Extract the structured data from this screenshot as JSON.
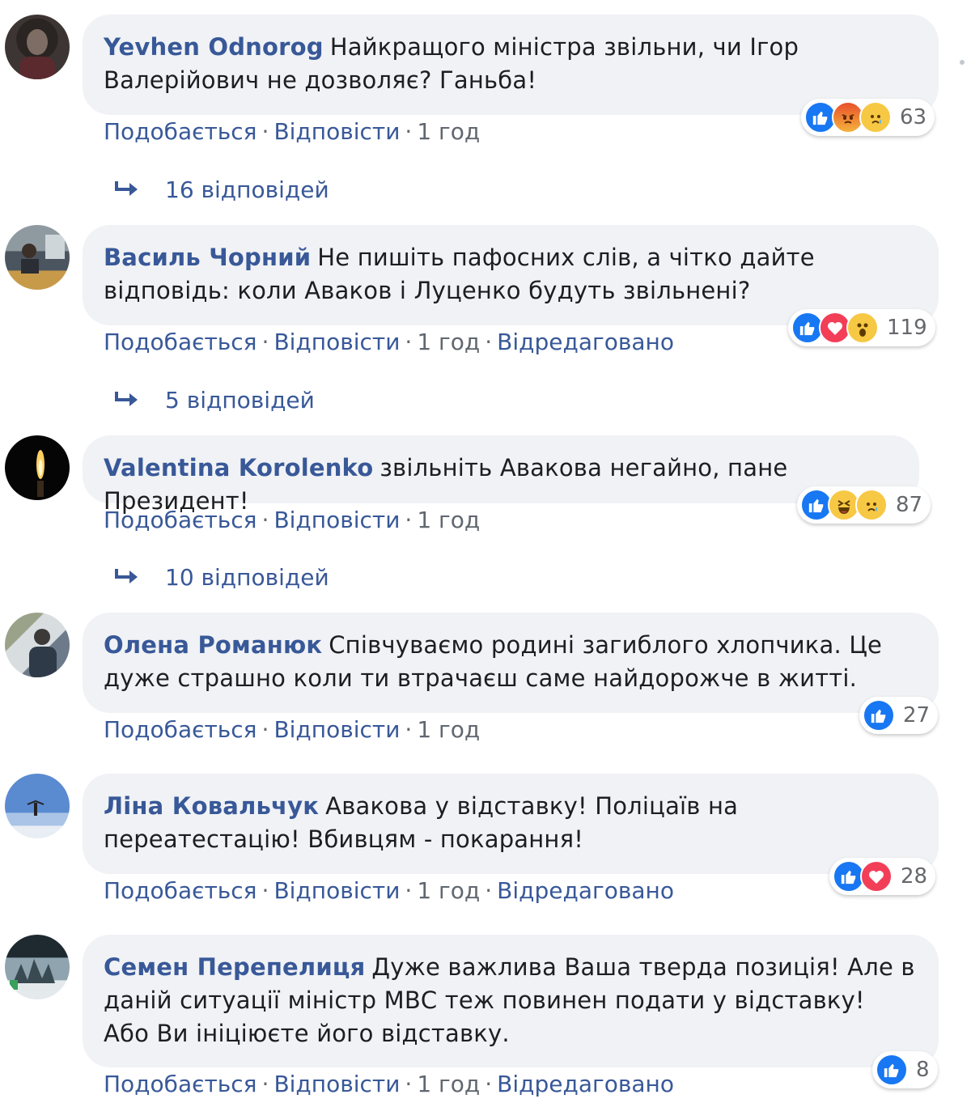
{
  "actions": {
    "like": "Подобається",
    "reply": "Відповісти",
    "edited": "Відредаговано",
    "separator": "·"
  },
  "colors": {
    "link": "#385898",
    "bubble": "#f0f2f5",
    "meta": "#606770",
    "like_blue": "#1877f2"
  },
  "comments": [
    {
      "author": "Yevhen Odnorog",
      "text": "Найкращого міністра звільни, чи Ігор Валерійович не дозволяє? Ганьба!",
      "time": "1 год",
      "edited": false,
      "reactions": [
        "like-icon",
        "angry-icon",
        "sad-icon"
      ],
      "reaction_count": "63",
      "replies": "16 відповідей",
      "avatar": "dark-portrait"
    },
    {
      "author": "Василь Чорний",
      "text": "Не пишіть пафосних слів, а чітко дайте відповідь: коли Аваков і Луценко будуть звільнені?",
      "time": "1 год",
      "edited": true,
      "reactions": [
        "like-icon",
        "love-icon",
        "wow-icon"
      ],
      "reaction_count": "119",
      "replies": "5 відповідей",
      "avatar": "office-portrait"
    },
    {
      "author": "Valentina Korolenko",
      "text": "звільніть Авакова негайно, пане Президент!",
      "time": "1 год",
      "edited": false,
      "reactions": [
        "like-icon",
        "haha-icon",
        "sad-icon"
      ],
      "reaction_count": "87",
      "replies": "10 відповідей",
      "avatar": "candle"
    },
    {
      "author": "Олена Романюк",
      "text": "Співчуваємо родині загиблого хлопчика. Це дуже страшно коли ти втрачаєш саме найдорожче в житті.",
      "time": "1 год",
      "edited": false,
      "reactions": [
        "like-icon"
      ],
      "reaction_count": "27",
      "replies": "",
      "avatar": "outdoor-portrait"
    },
    {
      "author": "Ліна Ковальчук",
      "text": "Авакова у відставку! Поліцаїв на переатестацію! Вбивцям - покарання!",
      "time": "1 год",
      "edited": true,
      "reactions": [
        "like-icon",
        "love-icon"
      ],
      "reaction_count": "28",
      "replies": "",
      "avatar": "sky-figure"
    },
    {
      "author": "Семен Перепелиця",
      "text": "Дуже важлива Ваша тверда позиція! Але в даній ситуації міністр МВС теж повинен подати у відставку! Або Ви ініціюєте його відставку.",
      "time": "1 год",
      "edited": true,
      "reactions": [
        "like-icon"
      ],
      "reaction_count": "8",
      "replies": "",
      "avatar": "mountain-group"
    }
  ]
}
